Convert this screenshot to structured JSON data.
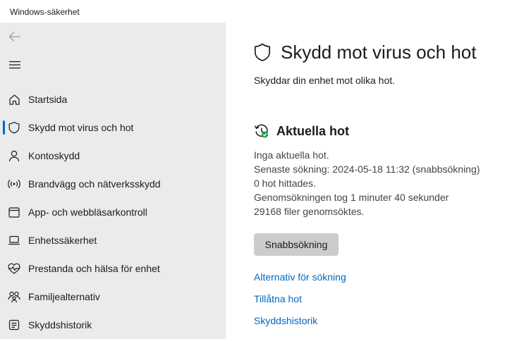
{
  "window": {
    "title": "Windows-säkerhet"
  },
  "sidebar": {
    "items": [
      {
        "label": "Startsida",
        "icon": "home-icon"
      },
      {
        "label": "Skydd mot virus och hot",
        "icon": "shield-icon",
        "active": true
      },
      {
        "label": "Kontoskydd",
        "icon": "person-icon"
      },
      {
        "label": "Brandvägg och nätverksskydd",
        "icon": "wifi-icon"
      },
      {
        "label": "App- och webbläsarkontroll",
        "icon": "app-window-icon"
      },
      {
        "label": "Enhetssäkerhet",
        "icon": "laptop-icon"
      },
      {
        "label": "Prestanda och hälsa för enhet",
        "icon": "heart-pulse-icon"
      },
      {
        "label": "Familjealternativ",
        "icon": "family-icon"
      },
      {
        "label": "Skyddshistorik",
        "icon": "history-icon"
      }
    ]
  },
  "main": {
    "title": "Skydd mot virus och hot",
    "subtitle": "Skyddar din enhet mot olika hot.",
    "current_threats": {
      "heading": "Aktuella hot",
      "lines": [
        "Inga aktuella hot.",
        "Senaste sökning: 2024-05-18 11:32 (snabbsökning)",
        "0 hot hittades.",
        "Genomsökningen tog 1 minuter 40 sekunder",
        "29168 filer genomsöktes."
      ],
      "button_label": "Snabbsökning",
      "links": [
        "Alternativ för sökning",
        "Tillåtna hot",
        "Skyddshistorik"
      ]
    }
  },
  "colors": {
    "accent": "#0067c0",
    "sidebar_bg": "#ebebeb",
    "button_bg": "#cccccc",
    "status_ok": "#16a34a"
  }
}
